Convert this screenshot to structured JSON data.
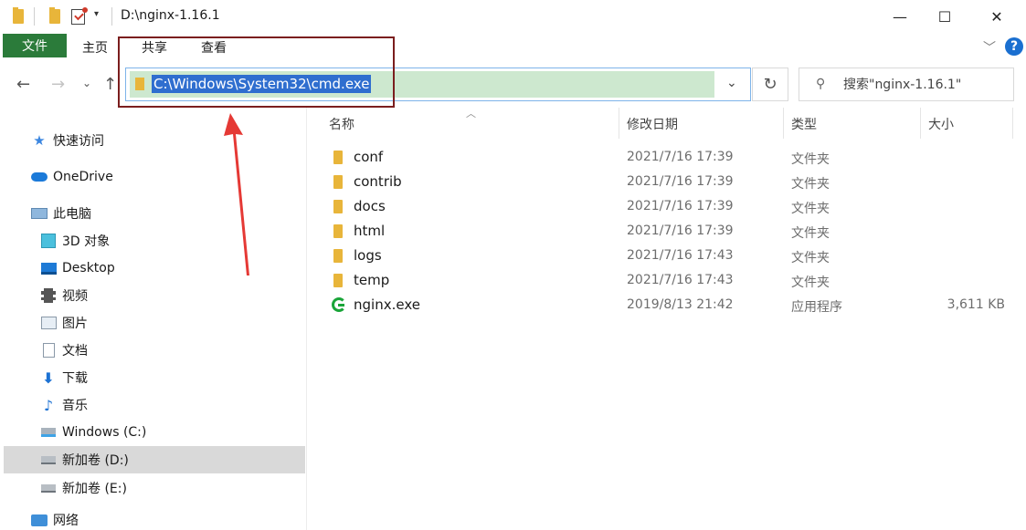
{
  "window": {
    "title": "D:\\nginx-1.16.1",
    "minimize": "—",
    "maximize": "☐",
    "close": "✕"
  },
  "ribbon": {
    "tabs": [
      "文件",
      "主页",
      "共享",
      "查看"
    ]
  },
  "address": {
    "value": "C:\\Windows\\System32\\cmd.exe"
  },
  "search": {
    "placeholder": "搜索\"nginx-1.16.1\""
  },
  "sidebar": {
    "items": [
      {
        "label": "快速访问",
        "icon": "star-icon"
      },
      {
        "label": "OneDrive",
        "icon": "cloud-icon"
      },
      {
        "label": "此电脑",
        "icon": "computer-icon"
      },
      {
        "label": "3D 对象",
        "icon": "cube-icon"
      },
      {
        "label": "Desktop",
        "icon": "desktop-icon"
      },
      {
        "label": "视频",
        "icon": "video-icon"
      },
      {
        "label": "图片",
        "icon": "picture-icon"
      },
      {
        "label": "文档",
        "icon": "document-icon"
      },
      {
        "label": "下载",
        "icon": "download-icon"
      },
      {
        "label": "音乐",
        "icon": "music-icon"
      },
      {
        "label": "Windows (C:)",
        "icon": "windows-drive-icon"
      },
      {
        "label": "新加卷 (D:)",
        "icon": "drive-icon",
        "selected": true
      },
      {
        "label": "新加卷 (E:)",
        "icon": "drive-icon"
      },
      {
        "label": "网络",
        "icon": "network-icon"
      }
    ]
  },
  "files": {
    "columns": [
      "名称",
      "修改日期",
      "类型",
      "大小"
    ],
    "rows": [
      {
        "name": "conf",
        "date": "2021/7/16 17:39",
        "type": "文件夹",
        "size": "",
        "icon": "folder-icon"
      },
      {
        "name": "contrib",
        "date": "2021/7/16 17:39",
        "type": "文件夹",
        "size": "",
        "icon": "folder-icon"
      },
      {
        "name": "docs",
        "date": "2021/7/16 17:39",
        "type": "文件夹",
        "size": "",
        "icon": "folder-icon"
      },
      {
        "name": "html",
        "date": "2021/7/16 17:39",
        "type": "文件夹",
        "size": "",
        "icon": "folder-icon"
      },
      {
        "name": "logs",
        "date": "2021/7/16 17:43",
        "type": "文件夹",
        "size": "",
        "icon": "folder-icon"
      },
      {
        "name": "temp",
        "date": "2021/7/16 17:43",
        "type": "文件夹",
        "size": "",
        "icon": "folder-icon"
      },
      {
        "name": "nginx.exe",
        "date": "2019/8/13 21:42",
        "type": "应用程序",
        "size": "3,611 KB",
        "icon": "nginx-exe-icon"
      }
    ]
  },
  "colors": {
    "file_tab": "#2b7b3a",
    "selection": "#2f6ecf",
    "annotation": "#e53935",
    "highlight_box": "#7b1e1e"
  }
}
